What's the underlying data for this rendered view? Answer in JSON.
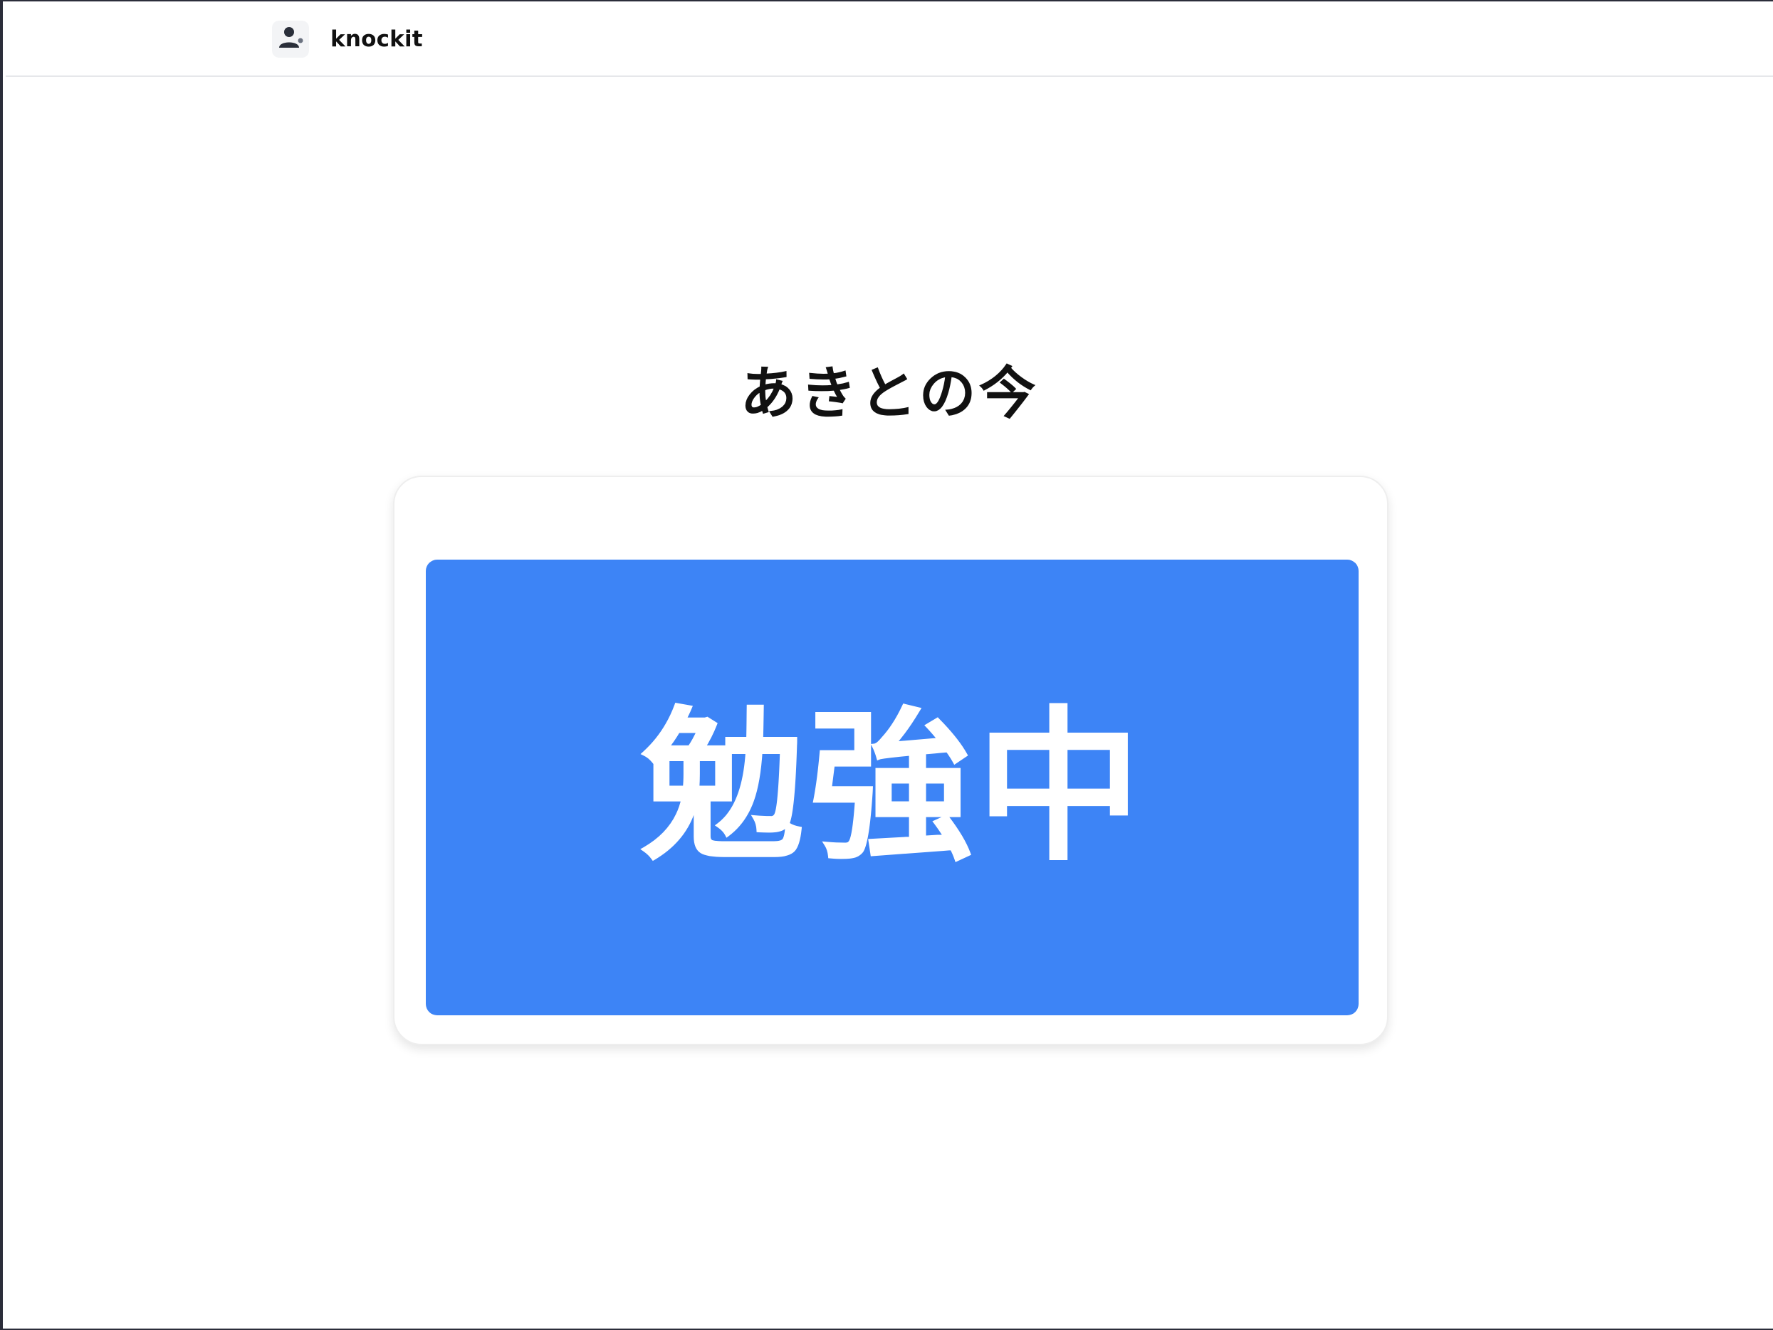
{
  "header": {
    "app_name": "knockit",
    "avatar_icon": "user-icon"
  },
  "main": {
    "title": "あきとの今",
    "status_label": "勉強中",
    "status_color": "#3d84f6"
  }
}
